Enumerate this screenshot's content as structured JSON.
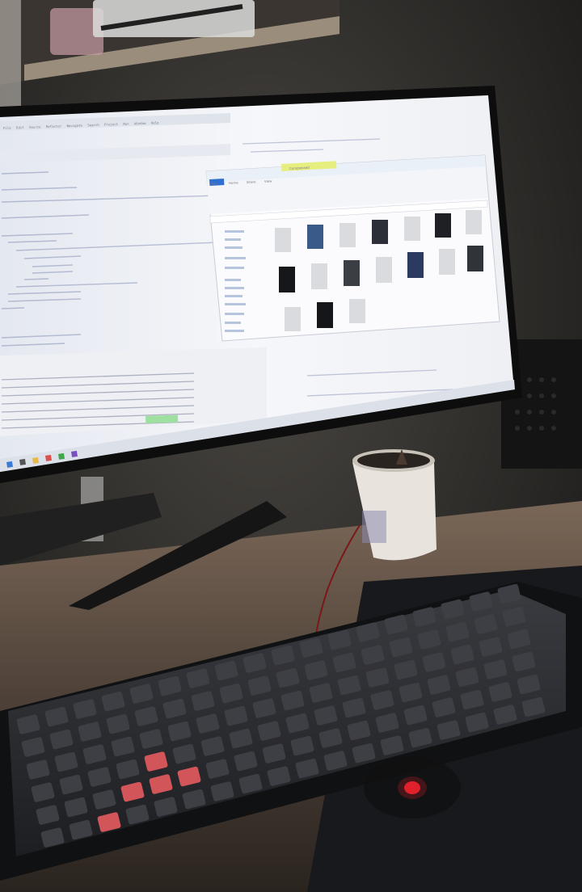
{
  "scene": {
    "description_free": true,
    "colors": {
      "room_dark": "#1c1b1a",
      "wall": "#2a2827",
      "shelf": "#8c8070",
      "desk": "#6b5a4c",
      "screen_glow": "#eef0f4",
      "keyboard": "#2b2c30",
      "accent_keys": "#d2555a",
      "mouse_led": "#e0202a"
    }
  },
  "monitor": {
    "ide": {
      "menu_items": [
        "File",
        "Edit",
        "Source",
        "Refactor",
        "Navigate",
        "Search",
        "Project",
        "Run",
        "Window",
        "Help"
      ]
    },
    "file_explorer": {
      "ribbon_tabs": [
        "File",
        "Home",
        "Share",
        "View"
      ],
      "highlight_label": "Compressed"
    },
    "taskbar": {
      "icons": [
        "start-icon",
        "search-icon",
        "files-icon",
        "browser-icon",
        "ide-icon",
        "terminal-icon"
      ]
    }
  },
  "icons": [
    "monitor-icon",
    "keyboard-icon",
    "mug-icon",
    "mouse-icon"
  ]
}
